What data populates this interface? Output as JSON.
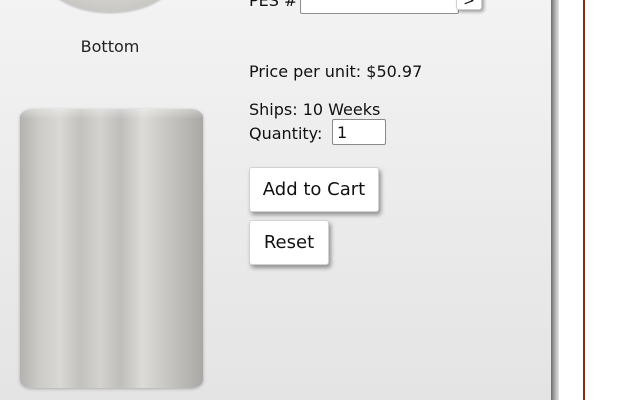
{
  "product_images": {
    "top_view_label": "",
    "bottom_view_label": "Bottom"
  },
  "search": {
    "label": "PES #",
    "value": "",
    "go_label": ">"
  },
  "details": {
    "price": "Price per unit: $50.97",
    "ships": "Ships: 10 Weeks",
    "quantity_label": "Quantity:",
    "quantity_value": "1"
  },
  "actions": {
    "add_to_cart_label": "Add to Cart",
    "reset_label": "Reset"
  },
  "colors": {
    "accent_rule": "#8b2a14",
    "panel_background": "#ececec"
  }
}
